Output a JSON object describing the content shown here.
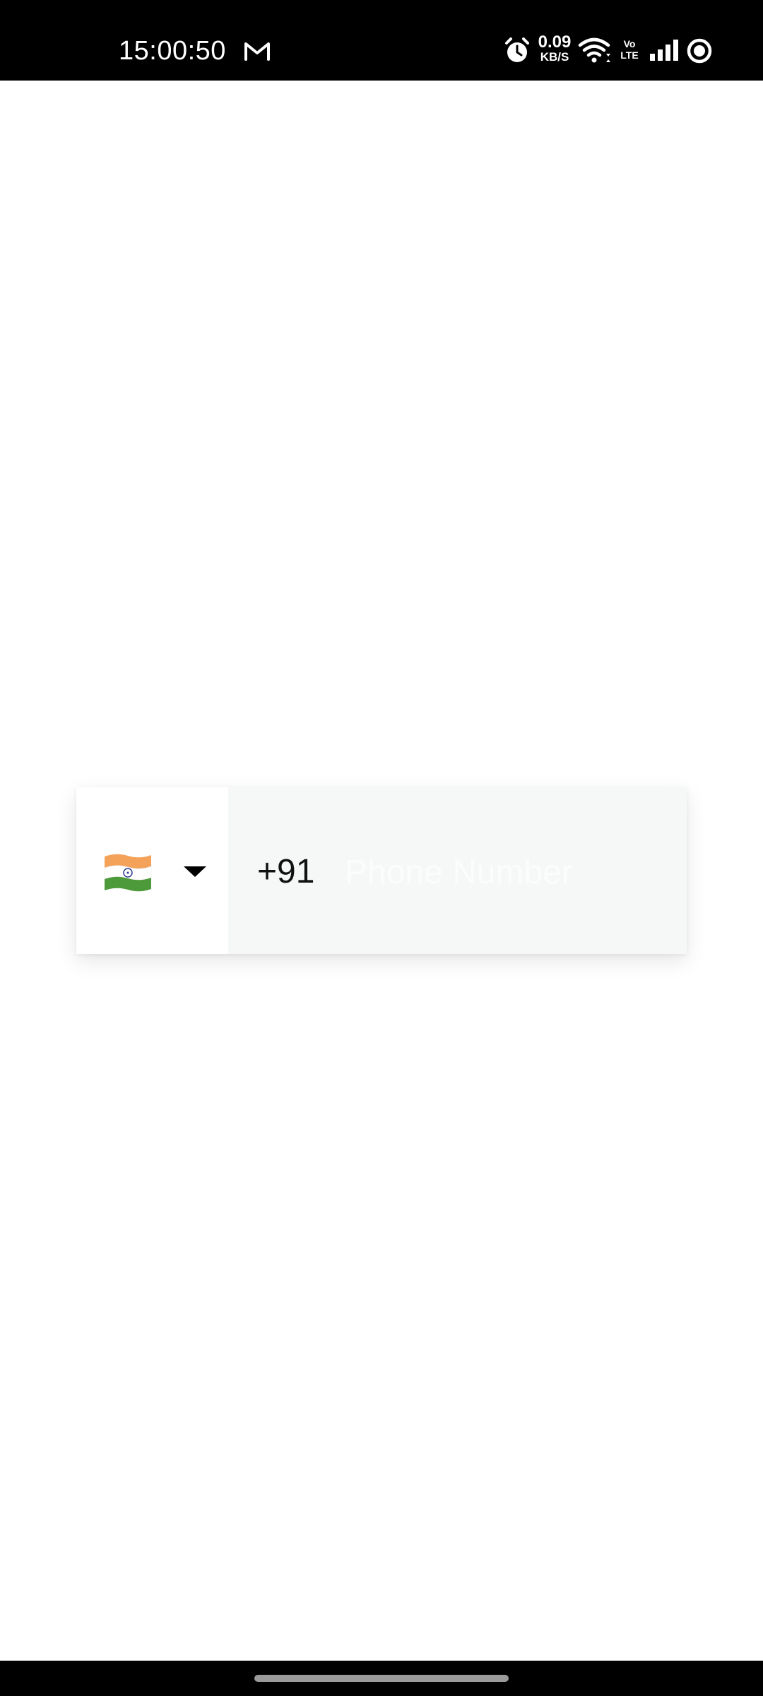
{
  "status_bar": {
    "time": "15:00:50",
    "net_speed_value": "0.09",
    "net_speed_unit": "KB/S",
    "volte_top": "Vo",
    "volte_bottom": "LTE",
    "icons": [
      "gmail-icon",
      "alarm-icon",
      "wifi-icon",
      "volte-icon",
      "signal-icon",
      "ring-icon"
    ]
  },
  "phone_form": {
    "country_flag": "india-flag-icon",
    "dial_code": "+91",
    "phone_value": "",
    "phone_placeholder": "Phone Number"
  },
  "colors": {
    "status_bar_bg": "#000000",
    "card_bg": "#f6f8f7",
    "flag_saffron": "#f4a259",
    "flag_white": "#ffffff",
    "flag_green": "#4d9a3a",
    "chakra_blue": "#2b3a8c"
  }
}
